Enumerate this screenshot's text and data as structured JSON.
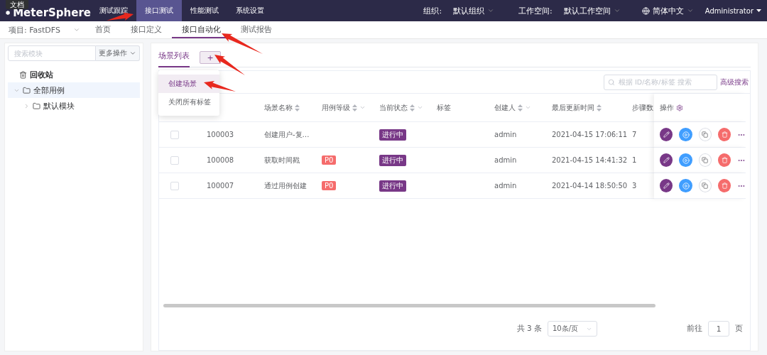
{
  "top_nav": {
    "logo": "MeterSphere",
    "tooltip": "文档",
    "tabs": [
      {
        "label": "测试跟踪",
        "selected": false
      },
      {
        "label": "接口测试",
        "selected": true
      },
      {
        "label": "性能测试",
        "selected": false
      },
      {
        "label": "系统设置",
        "selected": false
      }
    ],
    "org_label": "组织:",
    "org_value": "默认组织",
    "workspace_label": "工作空间:",
    "workspace_value": "默认工作空间",
    "language": "简体中文",
    "user": "Administrator"
  },
  "sub_nav": {
    "project": "项目: FastDFS",
    "tabs": [
      {
        "label": "首页",
        "selected": false
      },
      {
        "label": "接口定义",
        "selected": false
      },
      {
        "label": "接口自动化",
        "selected": true
      },
      {
        "label": "测试报告",
        "selected": false
      }
    ]
  },
  "sidebar": {
    "search_placeholder": "搜索模块",
    "more_button": "更多操作",
    "tree": [
      {
        "kind": "trash",
        "label": "回收站",
        "selected": false
      },
      {
        "kind": "folder",
        "label": "全部用例",
        "selected": true,
        "expanded": true,
        "children": [
          {
            "kind": "folder",
            "label": "默认模块",
            "selected": false,
            "expanded": false
          }
        ]
      }
    ]
  },
  "main": {
    "tabs": [
      {
        "label": "场景列表",
        "selected": true
      }
    ],
    "add_button": "+",
    "menu": [
      {
        "label": "创建场景",
        "selected": true
      },
      {
        "label": "关闭所有标签",
        "selected": false
      }
    ],
    "search_placeholder": "根据 ID/名称/标签 搜索",
    "advanced_search": "高级搜索",
    "table": {
      "columns": [
        {
          "label": "场景名称",
          "sortable": true
        },
        {
          "label": "用例等级",
          "sortable": true,
          "filterable": true
        },
        {
          "label": "当前状态",
          "sortable": true,
          "filterable": true
        },
        {
          "label": "标签"
        },
        {
          "label": "创建人",
          "sortable": true,
          "filterable": true
        },
        {
          "label": "最后更新时间",
          "sortable": true
        },
        {
          "label": "步骤数"
        }
      ],
      "actions_label": "操作",
      "rows": [
        {
          "checked": false,
          "id": "100003",
          "name": "创建用户-复…",
          "status": "进行中",
          "creator": "admin",
          "updated": "2021-04-15 17:06:11",
          "steps": "7"
        },
        {
          "checked": false,
          "id": "100008",
          "name": "获取时间戳",
          "level": "P0",
          "status": "进行中",
          "creator": "admin",
          "updated": "2021-04-15 14:41:32",
          "steps": "1"
        },
        {
          "checked": false,
          "id": "100007",
          "name": "通过用例创建",
          "level": "P0",
          "status": "进行中",
          "creator": "admin",
          "updated": "2021-04-14 18:50:50",
          "steps": "3"
        }
      ]
    },
    "pagination": {
      "total": "共 3 条",
      "page_size": "10条/页",
      "goto_label": "前往",
      "page": "1",
      "page_suffix": "页"
    }
  }
}
